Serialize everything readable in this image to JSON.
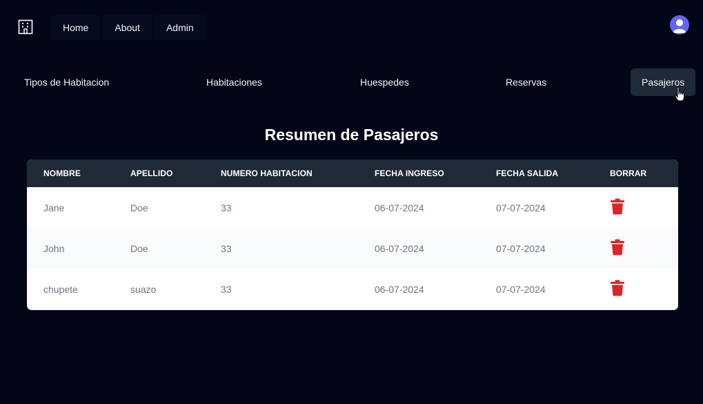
{
  "topnav": {
    "logo_icon": "building-icon",
    "items": [
      {
        "label": "Home"
      },
      {
        "label": "About"
      },
      {
        "label": "Admin"
      }
    ],
    "avatar_icon": "user-avatar-icon"
  },
  "subnav": {
    "items": [
      {
        "label": "Tipos de Habitacion"
      },
      {
        "label": "Habitaciones"
      },
      {
        "label": "Huespedes"
      },
      {
        "label": "Reservas"
      },
      {
        "label": "Pasajeros"
      }
    ],
    "active": "Pasajeros"
  },
  "page": {
    "title": "Resumen de Pasajeros"
  },
  "table": {
    "columns": [
      "NOMBRE",
      "APELLIDO",
      "NUMERO HABITACION",
      "FECHA INGRESO",
      "FECHA SALIDA",
      "BORRAR"
    ],
    "rows": [
      {
        "nombre": "Jane",
        "apellido": "Doe",
        "habitacion": "33",
        "ingreso": "06-07-2024",
        "salida": "07-07-2024"
      },
      {
        "nombre": "John",
        "apellido": "Doe",
        "habitacion": "33",
        "ingreso": "06-07-2024",
        "salida": "07-07-2024"
      },
      {
        "nombre": "chupete",
        "apellido": "suazo",
        "habitacion": "33",
        "ingreso": "06-07-2024",
        "salida": "07-07-2024"
      }
    ],
    "delete_icon": "trash-icon"
  },
  "colors": {
    "background": "#030617",
    "header_bg": "#1f2937",
    "active_tab_bg": "#1f2937",
    "avatar": "#6366f1",
    "delete": "#dc2626"
  }
}
